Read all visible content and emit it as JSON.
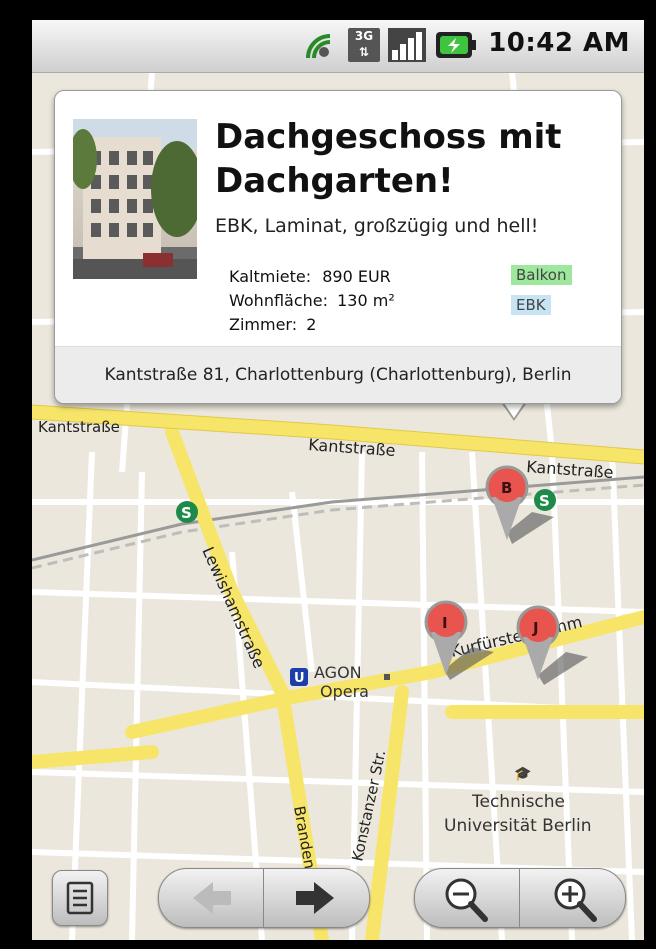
{
  "status_bar": {
    "time": "10:42 AM",
    "icons": [
      "sync-icon",
      "3g-icon",
      "signal-icon",
      "battery-charging-icon"
    ]
  },
  "listing": {
    "title_line1": "Dachgeschoss mit",
    "title_line2": "Dachgarten!",
    "subtitle": "EBK, Laminat, großzügig und hell!",
    "rent_label": "Kaltmiete:",
    "rent_value": "890 EUR",
    "area_label": "Wohnfläche:",
    "area_value": "130 m²",
    "rooms_label": "Zimmer:",
    "rooms_value": "2",
    "tags": [
      "Balkon",
      "EBK"
    ],
    "address": "Kantstraße 81, Charlottenburg (Charlottenburg), Berlin",
    "tag_colors": {
      "Balkon": "#9ee89e",
      "EBK": "#c7e4f5"
    }
  },
  "map": {
    "labels": {
      "kantstrasse_left": "Kantstraße",
      "kantstrasse_mid": "Kantstraße",
      "kantstrasse_right": "Kantstraße",
      "lewishamstrasse": "Lewishamstraße",
      "kurfuerstendamm": "Kurfürstendamm",
      "konstanzer": "Konstanzer Str.",
      "brandenburg": "Brandenb",
      "agon": "AGON",
      "opera": "Opera",
      "tu_line1": "Technische",
      "tu_line2": "Universität Berlin"
    },
    "markers": [
      "B",
      "I",
      "J"
    ],
    "transit_s": "S",
    "transit_u": "U",
    "road_color": "#f7e56a",
    "marker_color": "#e8544e"
  },
  "controls": {
    "list_button": "list-icon",
    "back_arrow": "arrow-left-icon",
    "forward_arrow": "arrow-right-icon",
    "zoom_out": "zoom-out-icon",
    "zoom_in": "zoom-in-icon"
  }
}
